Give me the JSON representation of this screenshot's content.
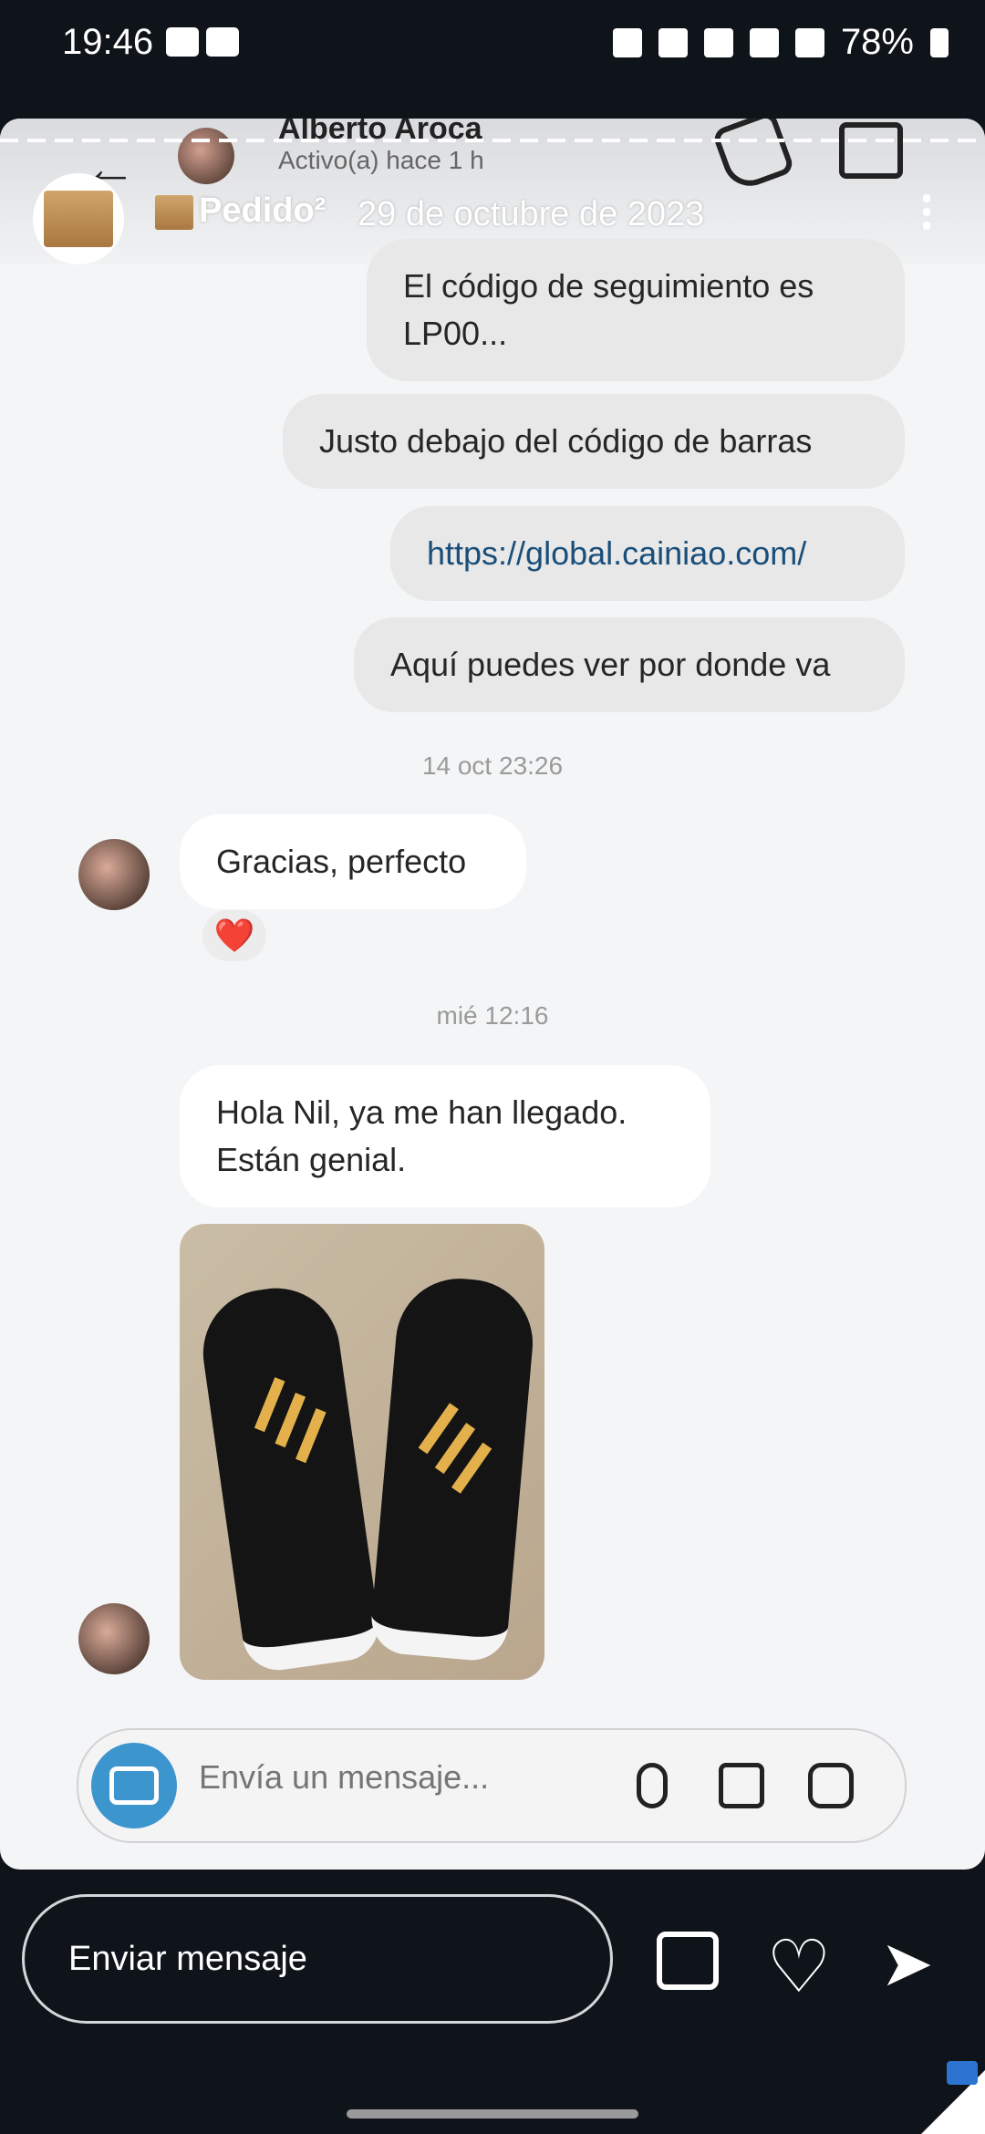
{
  "status_bar": {
    "time": "19:46",
    "battery": "78%"
  },
  "chat_header": {
    "name": "Alberto Aroca",
    "status": "Activo(a) hace 1 h"
  },
  "story": {
    "title": "Pedido²",
    "date": "29 de octubre de 2023"
  },
  "messages": [
    {
      "text": "El código de seguimiento es LP00..."
    },
    {
      "text": "Justo debajo del código de barras"
    },
    {
      "text": "https://global.cainiao.com/"
    },
    {
      "text": "Aquí puedes ver por donde va"
    },
    {
      "text": "Gracias, perfecto"
    },
    {
      "text": "Hola Nil, ya me han llegado. Están genial."
    }
  ],
  "timestamps": [
    "14 oct 23:26",
    "mié 12:16"
  ],
  "reaction": "❤️",
  "composer": {
    "placeholder": "Envía un mensaje..."
  },
  "reply": {
    "label": "Enviar mensaje"
  },
  "icons": [
    "back-icon",
    "phone-icon",
    "video-icon",
    "camera-icon",
    "mic-icon",
    "image-icon",
    "sticker-icon",
    "device-icon",
    "heart-icon",
    "send-icon"
  ],
  "colors": {
    "accent": "#3d95ce",
    "background": "#0f131a",
    "link": "#1a4e7a"
  }
}
